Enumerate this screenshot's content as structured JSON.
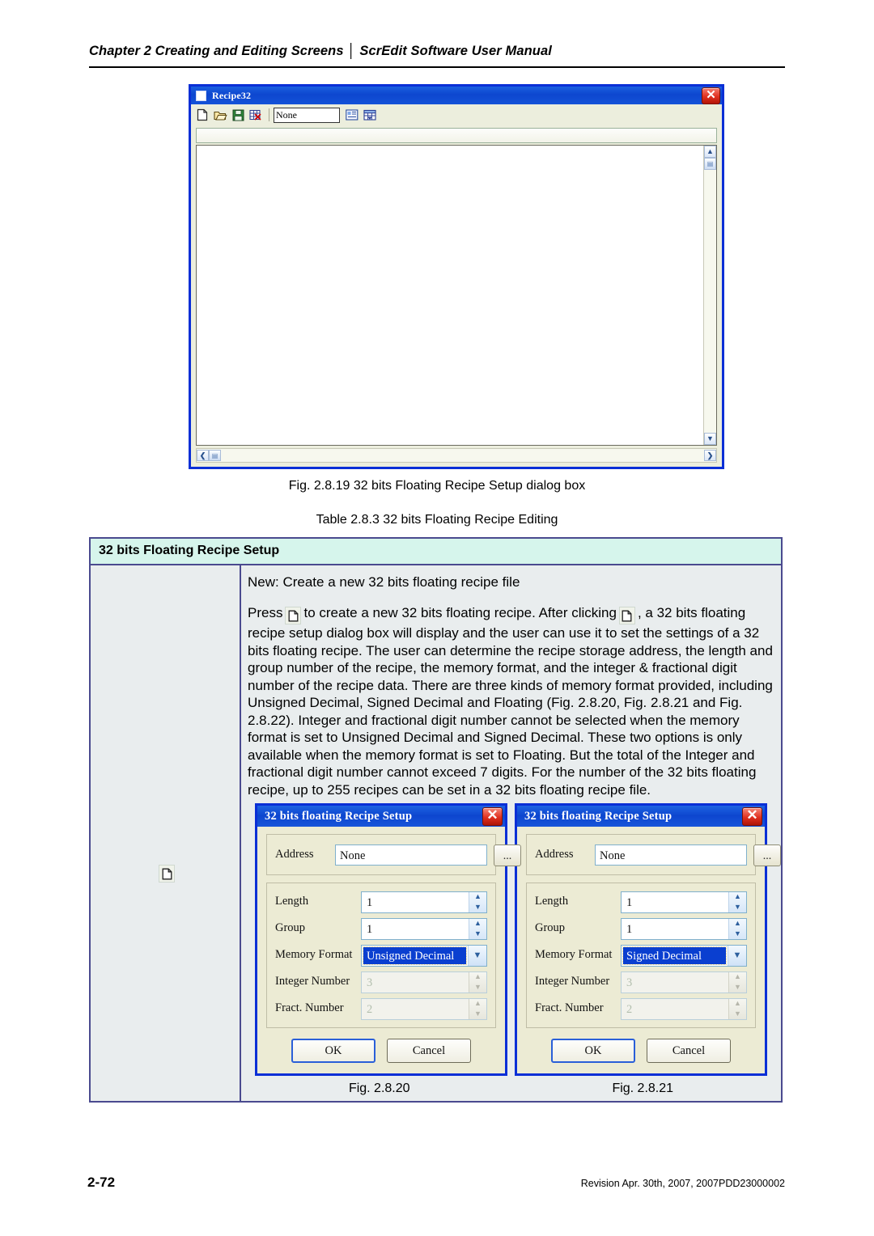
{
  "header": {
    "chapter": "Chapter 2  Creating and Editing Screens │ ScrEdit Software User Manual"
  },
  "recipe_window": {
    "title": "Recipe32",
    "icon": "window-icon",
    "close_label": "✕",
    "toolbar": {
      "new_icon": "new-document-icon",
      "open_icon": "open-folder-icon",
      "save_icon": "save-disk-icon",
      "delete_icon": "delete-table-icon",
      "address_value": "None",
      "properties_icon": "properties-icon",
      "grid_icon": "grid-table-icon"
    },
    "scroll": {
      "up": "▲",
      "down": "▼",
      "left": "❮",
      "right": "❯",
      "thumb": "▤"
    }
  },
  "captions": {
    "fig_main": "Fig. 2.8.19 32 bits Floating Recipe Setup dialog box",
    "table_caption": "Table 2.8.3 32 bits Floating Recipe Editing"
  },
  "table": {
    "header": "32 bits Floating Recipe Setup",
    "left_cell_icon": "new-document-icon",
    "body": {
      "line1": "New: Create a new 32 bits floating recipe file",
      "p2_before": "Press",
      "p2_mid": "to create a new 32 bits floating recipe. After clicking",
      "p2_after": ", a 32 bits floating recipe setup dialog box will display and the user can use it to set the settings of a 32 bits floating recipe. The user can determine the recipe storage address, the length and group number of the recipe, the memory format, and the integer & fractional digit number of the recipe data. There are three kinds of memory format provided, including Unsigned Decimal, Signed Decimal and Floating (Fig. 2.8.20, Fig. 2.8.21 and Fig. 2.8.22). Integer and fractional digit number cannot be selected when the memory format is set to Unsigned Decimal and Signed Decimal. These two options is only available when the memory format is set to Floating. But the total of the Integer and fractional digit number cannot exceed 7 digits. For the number of the 32 bits floating recipe, up to 255 recipes can be set in a 32 bits floating recipe file."
    }
  },
  "dialogs": [
    {
      "title": "32 bits floating Recipe Setup",
      "close_label": "✕",
      "address_label": "Address",
      "address_value": "None",
      "browse_label": "...",
      "length_label": "Length",
      "length_value": "1",
      "group_label": "Group",
      "group_value": "1",
      "memory_format_label": "Memory Format",
      "memory_format_value": "Unsigned Decimal",
      "integer_label": "Integer Number",
      "integer_value": "3",
      "fract_label": "Fract. Number",
      "fract_value": "2",
      "ok_label": "OK",
      "cancel_label": "Cancel",
      "fig_label": "Fig. 2.8.20"
    },
    {
      "title": "32 bits floating Recipe Setup",
      "close_label": "✕",
      "address_label": "Address",
      "address_value": "None",
      "browse_label": "...",
      "length_label": "Length",
      "length_value": "1",
      "group_label": "Group",
      "group_value": "1",
      "memory_format_label": "Memory Format",
      "memory_format_value": "Signed Decimal",
      "integer_label": "Integer Number",
      "integer_value": "3",
      "fract_label": "Fract. Number",
      "fract_value": "2",
      "ok_label": "OK",
      "cancel_label": "Cancel",
      "fig_label": "Fig. 2.8.21"
    }
  ],
  "footer": {
    "page_number": "2-72",
    "revision": "Revision Apr. 30th, 2007, 2007PDD23000002"
  },
  "spinner_glyphs": {
    "up": "▲",
    "down": "▼",
    "combo_arrow": "▼"
  }
}
